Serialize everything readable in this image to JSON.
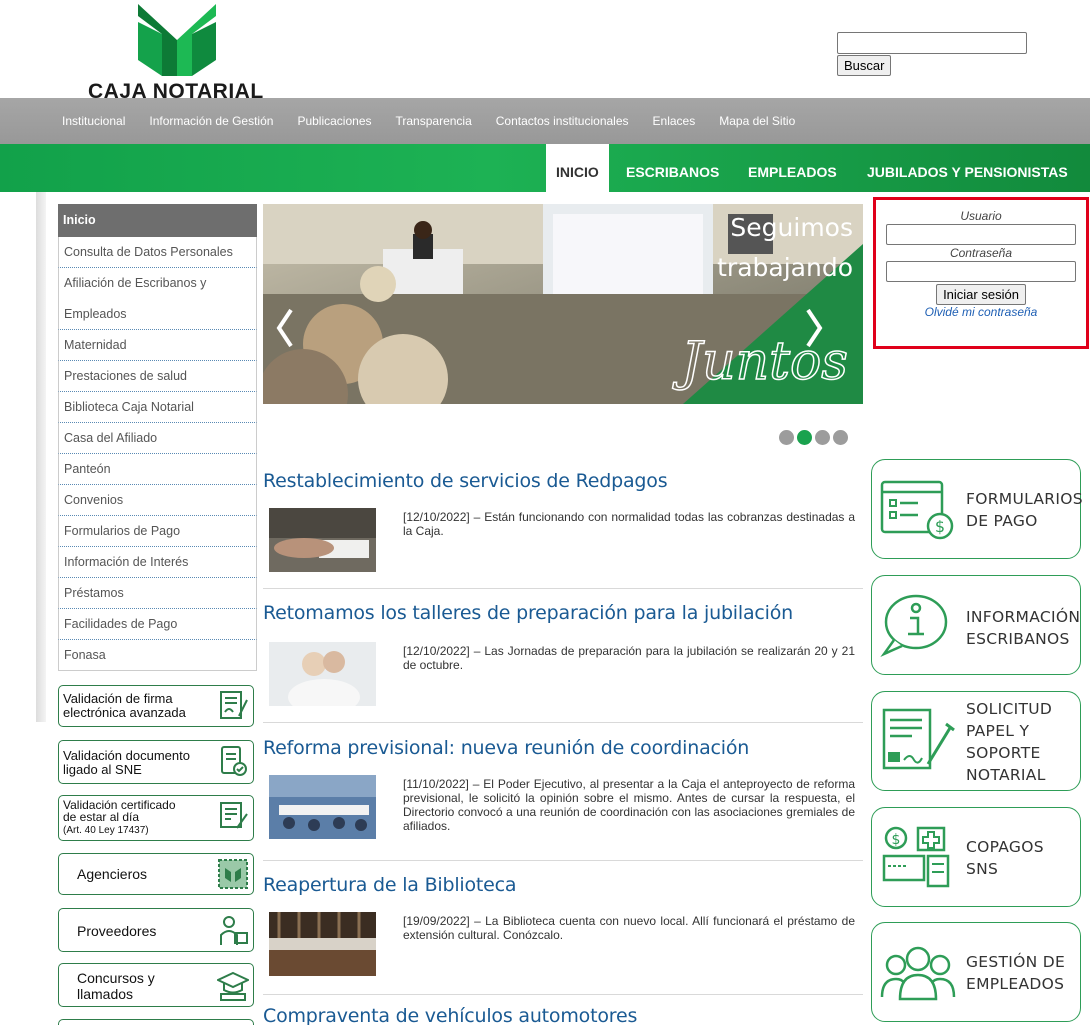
{
  "header": {
    "brand": "CAJA NOTARIAL",
    "search_button": "Buscar",
    "search_value": ""
  },
  "top_nav": [
    "Institucional",
    "Información de Gestión",
    "Publicaciones",
    "Transparencia",
    "Contactos institucionales",
    "Enlaces",
    "Mapa del Sitio"
  ],
  "main_nav": {
    "tabs": [
      "INICIO",
      "ESCRIBANOS",
      "EMPLEADOS",
      "JUBILADOS Y PENSIONISTAS"
    ],
    "active": "INICIO"
  },
  "sidebar": {
    "items": [
      "Inicio",
      "Consulta de Datos Personales",
      "Afiliación de Escribanos y",
      "Empleados",
      "Maternidad",
      "Prestaciones de salud",
      "Biblioteca Caja Notarial",
      "Casa del Afiliado",
      "Panteón",
      "Convenios",
      "Formularios de Pago",
      "Información de Interés",
      "Préstamos",
      "Facilidades de Pago",
      "Fonasa"
    ],
    "buttons": {
      "firma_l1": "Validación de firma",
      "firma_l2": "electrónica avanzada",
      "doc_l1": "Validación documento",
      "doc_l2": "ligado al SNE",
      "cert_l1": "Validación certificado",
      "cert_l2": "de estar al día",
      "cert_l3": "(Art. 40 Ley 17437)",
      "agencieros": "Agencieros",
      "proveedores": "Proveedores",
      "concursos_l1": "Concursos y",
      "concursos_l2": "llamados"
    }
  },
  "carousel": {
    "line1": "Seguimos",
    "line2": "trabajando",
    "script_text": "Juntos",
    "slide_count": 4,
    "active_slide": 2
  },
  "news": [
    {
      "title": "Restablecimiento de servicios de Redpagos",
      "text": "[12/10/2022] – Están funcionando con normalidad todas las cobranzas destinadas a la Caja."
    },
    {
      "title": "Retomamos los talleres de preparación para la jubilación",
      "text": "[12/10/2022] – Las Jornadas de preparación para la jubilación se realizarán 20 y 21 de octubre."
    },
    {
      "title": "Reforma previsional: nueva reunión de coordinación",
      "text": "[11/10/2022] – El Poder Ejecutivo, al presentar a la Caja el anteproyecto de reforma previsional, le solicitó la opinión sobre el mismo. Antes de cursar la respuesta, el Directorio convocó a una reunión de coordinación con las asociaciones gremiales de afiliados."
    },
    {
      "title": "Reapertura de la Biblioteca",
      "text": "[19/09/2022] – La Biblioteca cuenta con nuevo local. Allí funcionará el préstamo de extensión cultural. Conózcalo."
    },
    {
      "title": "Compraventa de vehículos automotores",
      "text": ""
    }
  ],
  "login": {
    "user_label": "Usuario",
    "password_label": "Contraseña",
    "submit": "Iniciar sesión",
    "forgot": "Olvidé mi contraseña"
  },
  "cards": {
    "formularios_l1": "FORMULARIOS",
    "formularios_l2": "DE PAGO",
    "info_l1": "INFORMACIÓN",
    "info_l2": "ESCRIBANOS",
    "sol_l1": "SOLICITUD",
    "sol_l2": "PAPEL Y",
    "sol_l3": "SOPORTE",
    "sol_l4": "NOTARIAL",
    "copagos_l1": "COPAGOS",
    "copagos_l2": "SNS",
    "gestion_l1": "GESTIÓN DE",
    "gestion_l2": "EMPLEADOS"
  },
  "colors": {
    "brand_green": "#1aa24e",
    "nav_grey": "#9f9f9f",
    "link_blue": "#1a5a93",
    "highlight_red": "#e0001a"
  }
}
